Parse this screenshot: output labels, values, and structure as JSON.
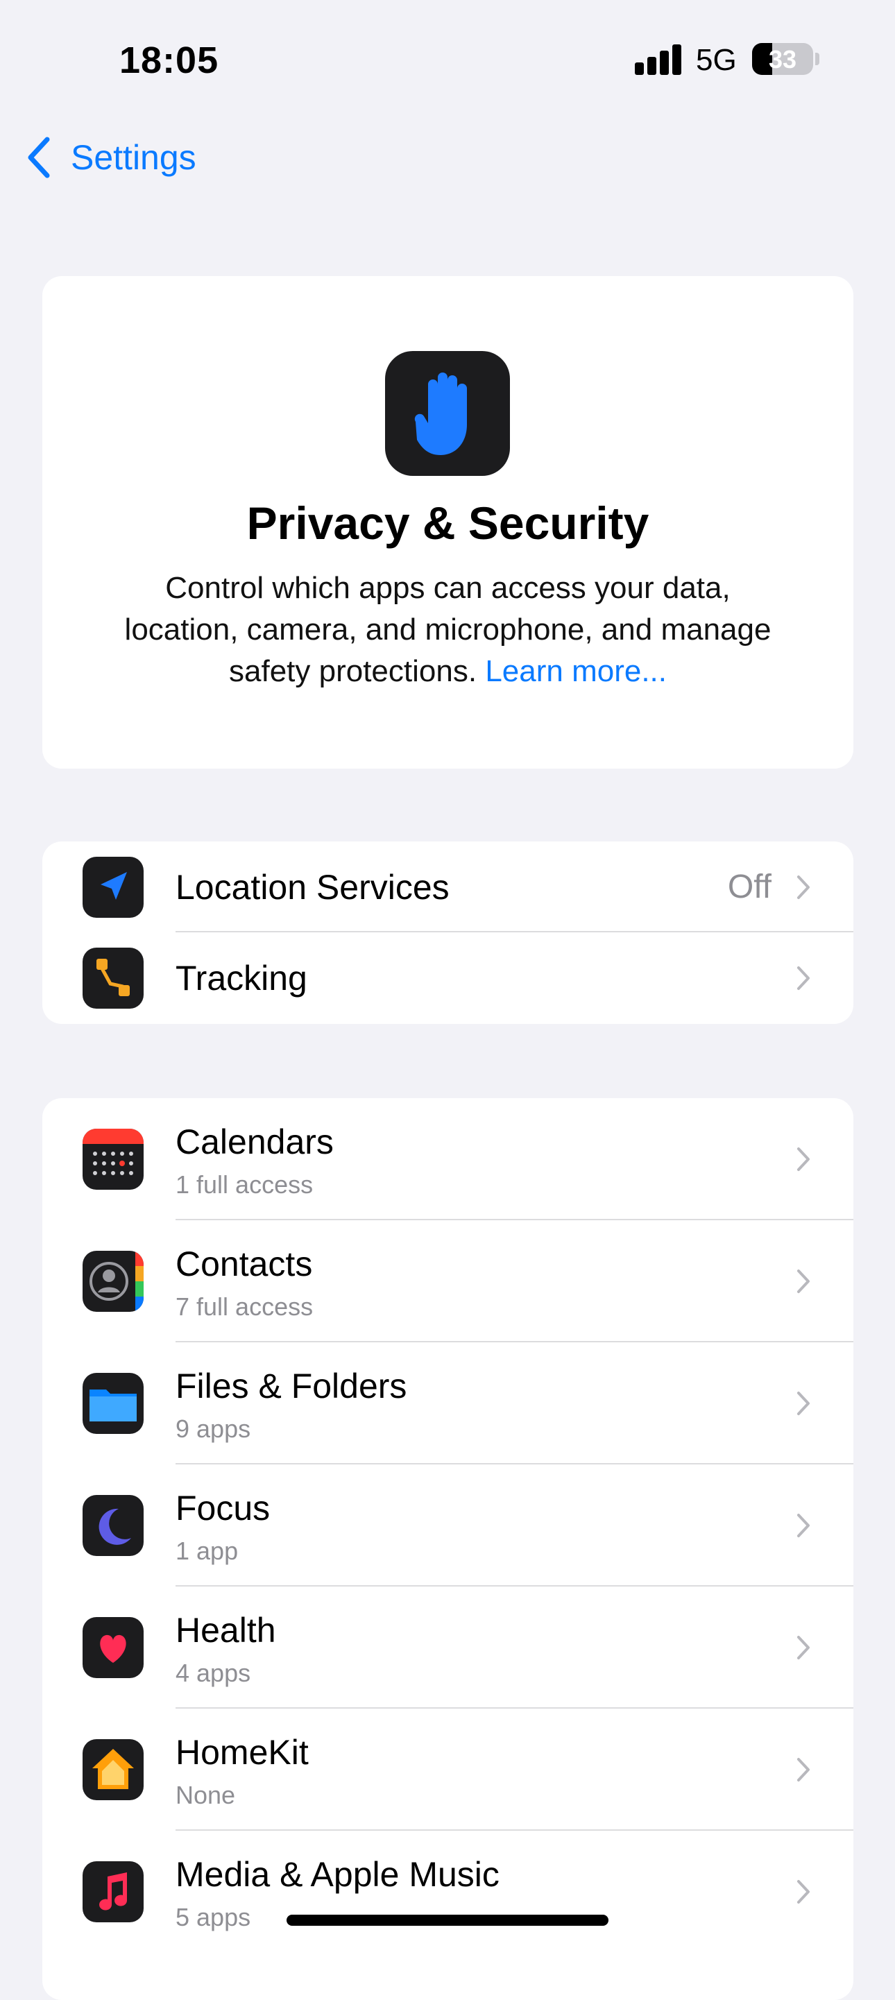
{
  "status_bar": {
    "time": "18:05",
    "network": "5G",
    "battery_percent": "33",
    "battery_level": 0.33
  },
  "nav": {
    "back_label": "Settings"
  },
  "hero": {
    "icon": "raised-hand-icon",
    "title": "Privacy & Security",
    "description": "Control which apps can access your data, location, camera, and microphone, and manage safety protections.",
    "learn_more": "Learn more..."
  },
  "section_top": [
    {
      "title": "Location Services",
      "value": "Off",
      "icon": "location-arrow-icon"
    },
    {
      "title": "Tracking",
      "value": "",
      "icon": "tracking-icon"
    }
  ],
  "section_apps": [
    {
      "title": "Calendars",
      "subtitle": "1 full access",
      "icon": "calendar-icon"
    },
    {
      "title": "Contacts",
      "subtitle": "7 full access",
      "icon": "contacts-icon"
    },
    {
      "title": "Files & Folders",
      "subtitle": "9 apps",
      "icon": "folder-icon"
    },
    {
      "title": "Focus",
      "subtitle": "1 app",
      "icon": "moon-icon"
    },
    {
      "title": "Health",
      "subtitle": "4 apps",
      "icon": "heart-icon"
    },
    {
      "title": "HomeKit",
      "subtitle": "None",
      "icon": "home-icon"
    },
    {
      "title": "Media & Apple Music",
      "subtitle": "5 apps",
      "icon": "music-note-icon"
    }
  ],
  "colors": {
    "accent": "#0A7AFF",
    "background": "#F2F2F7",
    "secondary_text": "#8E8E93"
  }
}
